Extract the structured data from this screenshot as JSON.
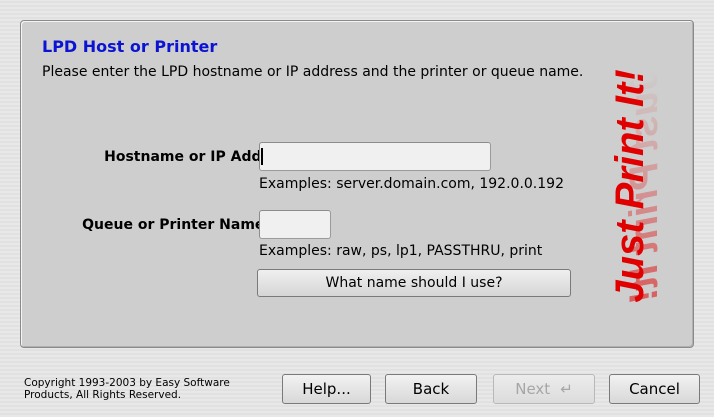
{
  "header": {
    "title": "LPD Host or Printer",
    "description": "Please enter the LPD hostname or IP address and the printer or queue name."
  },
  "form": {
    "hostname": {
      "label": "Hostname or IP Addr:",
      "value": "",
      "example": "Examples: server.domain.com, 192.0.0.192"
    },
    "queue": {
      "label": "Queue or Printer Name:",
      "value": "",
      "example": "Examples: raw, ps, lp1, PASSTHRU, print"
    },
    "help_name_button": "What name should I use?"
  },
  "brand": {
    "text": "Just Print It!",
    "color": "#e00000"
  },
  "footer": {
    "copyright": "Copyright 1993-2003 by Easy Software Products, All Rights Reserved.",
    "buttons": {
      "help": "Help...",
      "back": "Back",
      "next": "Next",
      "next_icon": "return-arrow-icon",
      "cancel": "Cancel"
    }
  },
  "colors": {
    "heading": "#0a14d2",
    "panel": "#cecece",
    "disabled_text": "#a6a6a6"
  }
}
